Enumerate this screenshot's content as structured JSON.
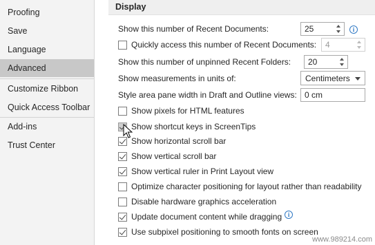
{
  "sidebar": {
    "items": [
      {
        "label": "Proofing"
      },
      {
        "label": "Save"
      },
      {
        "label": "Language"
      },
      {
        "label": "Advanced"
      },
      {
        "label": "Customize Ribbon"
      },
      {
        "label": "Quick Access Toolbar"
      },
      {
        "label": "Add-ins"
      },
      {
        "label": "Trust Center"
      }
    ],
    "selected": "Advanced"
  },
  "section": {
    "title": "Display"
  },
  "options": {
    "recent_docs_label": "Show this number of Recent Documents:",
    "recent_docs_value": "25",
    "quick_access_label": "Quickly access this number of Recent Documents:",
    "quick_access_value": "4",
    "recent_folders_label": "Show this number of unpinned Recent Folders:",
    "recent_folders_value": "20",
    "units_label": "Show measurements in units of:",
    "units_value": "Centimeters",
    "style_area_label": "Style area pane width in Draft and Outline views:",
    "style_area_value": "0 cm",
    "checkboxes": [
      {
        "label": "Show pixels for HTML features",
        "checked": false
      },
      {
        "label": "Show shortcut keys in ScreenTips",
        "checked": true
      },
      {
        "label": "Show horizontal scroll bar",
        "checked": true
      },
      {
        "label": "Show vertical scroll bar",
        "checked": true
      },
      {
        "label": "Show vertical ruler in Print Layout view",
        "checked": true
      },
      {
        "label": "Optimize character positioning for layout rather than readability",
        "checked": false
      },
      {
        "label": "Disable hardware graphics acceleration",
        "checked": false
      },
      {
        "label": "Update document content while dragging",
        "checked": true
      },
      {
        "label": "Use subpixel positioning to smooth fonts on screen",
        "checked": true
      }
    ]
  },
  "watermark": "www.989214.com",
  "colors": {
    "sidebar_bg": "#f3f3f3",
    "selected_bg": "#c8c8c8",
    "info_blue": "#2f78c4"
  }
}
